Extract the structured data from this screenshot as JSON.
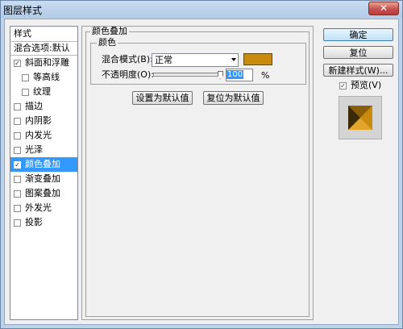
{
  "window": {
    "title": "图层样式",
    "close_glyph": "✕"
  },
  "style_list": {
    "header": "样式",
    "blend_row": "混合选项:默认",
    "items": [
      {
        "label": "斜面和浮雕",
        "checked": true,
        "sub": false,
        "selected": false
      },
      {
        "label": "等高线",
        "checked": false,
        "sub": true,
        "selected": false
      },
      {
        "label": "纹理",
        "checked": false,
        "sub": true,
        "selected": false
      },
      {
        "label": "描边",
        "checked": false,
        "sub": false,
        "selected": false
      },
      {
        "label": "内阴影",
        "checked": false,
        "sub": false,
        "selected": false
      },
      {
        "label": "内发光",
        "checked": false,
        "sub": false,
        "selected": false
      },
      {
        "label": "光泽",
        "checked": false,
        "sub": false,
        "selected": false
      },
      {
        "label": "颜色叠加",
        "checked": true,
        "sub": false,
        "selected": true
      },
      {
        "label": "渐变叠加",
        "checked": false,
        "sub": false,
        "selected": false
      },
      {
        "label": "图案叠加",
        "checked": false,
        "sub": false,
        "selected": false
      },
      {
        "label": "外发光",
        "checked": false,
        "sub": false,
        "selected": false
      },
      {
        "label": "投影",
        "checked": false,
        "sub": false,
        "selected": false
      }
    ]
  },
  "color_overlay": {
    "section_title": "颜色叠加",
    "group_title": "颜色",
    "blend_mode_label": "混合模式(B):",
    "blend_mode_value": "正常",
    "overlay_color": "#c98a0e",
    "opacity_label": "不透明度(O):",
    "opacity_value": "100",
    "opacity_fraction": 1.0,
    "opacity_unit": "%",
    "set_default_button": "设置为默认值",
    "reset_default_button": "复位为默认值"
  },
  "actions": {
    "ok": "确定",
    "reset": "复位",
    "new_style": "新建样式(W)...",
    "preview_label": "预览(V)",
    "preview_checked": true
  },
  "colors": {
    "selection": "#3399ff",
    "preview_gold": "#c98a0e",
    "preview_dark": "#3a2a08"
  }
}
